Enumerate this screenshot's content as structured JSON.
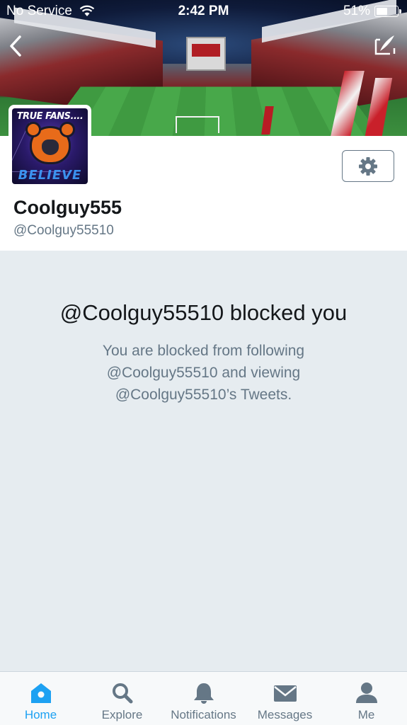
{
  "status_bar": {
    "carrier": "No Service",
    "time": "2:42 PM",
    "battery": "51%"
  },
  "profile": {
    "display_name": "Coolguy555",
    "handle": "@Coolguy55510",
    "avatar": {
      "top_text": "TRUE FANS....",
      "bottom_text": "BELIEVE"
    }
  },
  "blocked": {
    "title": "@Coolguy55510 blocked you",
    "message": "You are blocked from following @Coolguy55510 and viewing @Coolguy55510’s Tweets."
  },
  "tab_bar": {
    "active": "home",
    "tabs": [
      {
        "id": "home",
        "label": "Home",
        "icon": "home-icon"
      },
      {
        "id": "explore",
        "label": "Explore",
        "icon": "search-icon"
      },
      {
        "id": "notifications",
        "label": "Notifications",
        "icon": "bell-icon"
      },
      {
        "id": "messages",
        "label": "Messages",
        "icon": "envelope-icon"
      },
      {
        "id": "me",
        "label": "Me",
        "icon": "person-icon"
      }
    ]
  },
  "colors": {
    "accent": "#1da1f2",
    "text_primary": "#14171a",
    "text_secondary": "#657786",
    "background": "#e6ecf0"
  }
}
